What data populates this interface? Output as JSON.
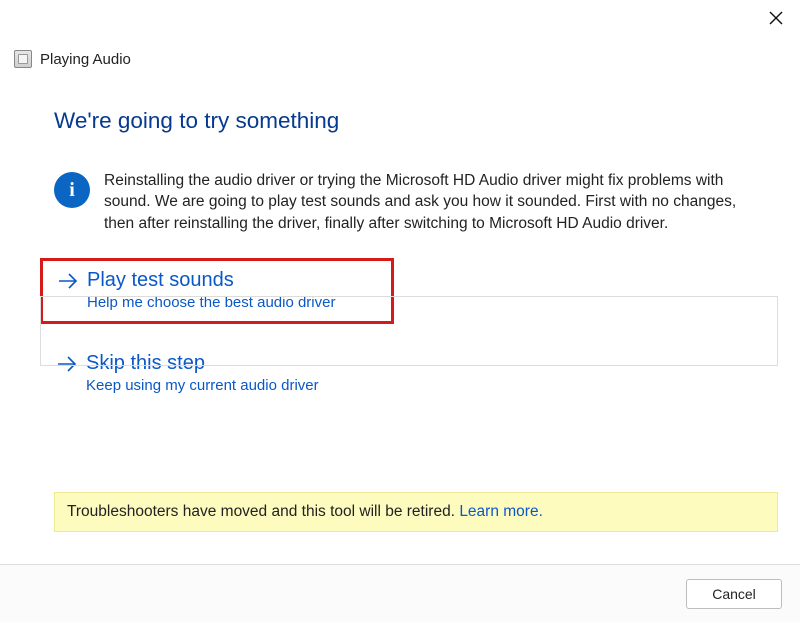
{
  "window": {
    "title": "Playing Audio"
  },
  "header": {
    "heading": "We're going to try something"
  },
  "info": {
    "icon_letter": "i",
    "text": "Reinstalling the audio driver or trying the Microsoft HD Audio driver might fix problems with sound. We are going to play test sounds and ask you how it sounded. First with no changes, then after reinstalling the driver, finally after switching to Microsoft HD Audio driver."
  },
  "options": [
    {
      "title": "Play test sounds",
      "subtitle": "Help me choose the best audio driver"
    },
    {
      "title": "Skip this step",
      "subtitle": "Keep using my current audio driver"
    }
  ],
  "notice": {
    "text": "Troubleshooters have moved and this tool will be retired. ",
    "link_label": "Learn more."
  },
  "footer": {
    "cancel_label": "Cancel"
  }
}
